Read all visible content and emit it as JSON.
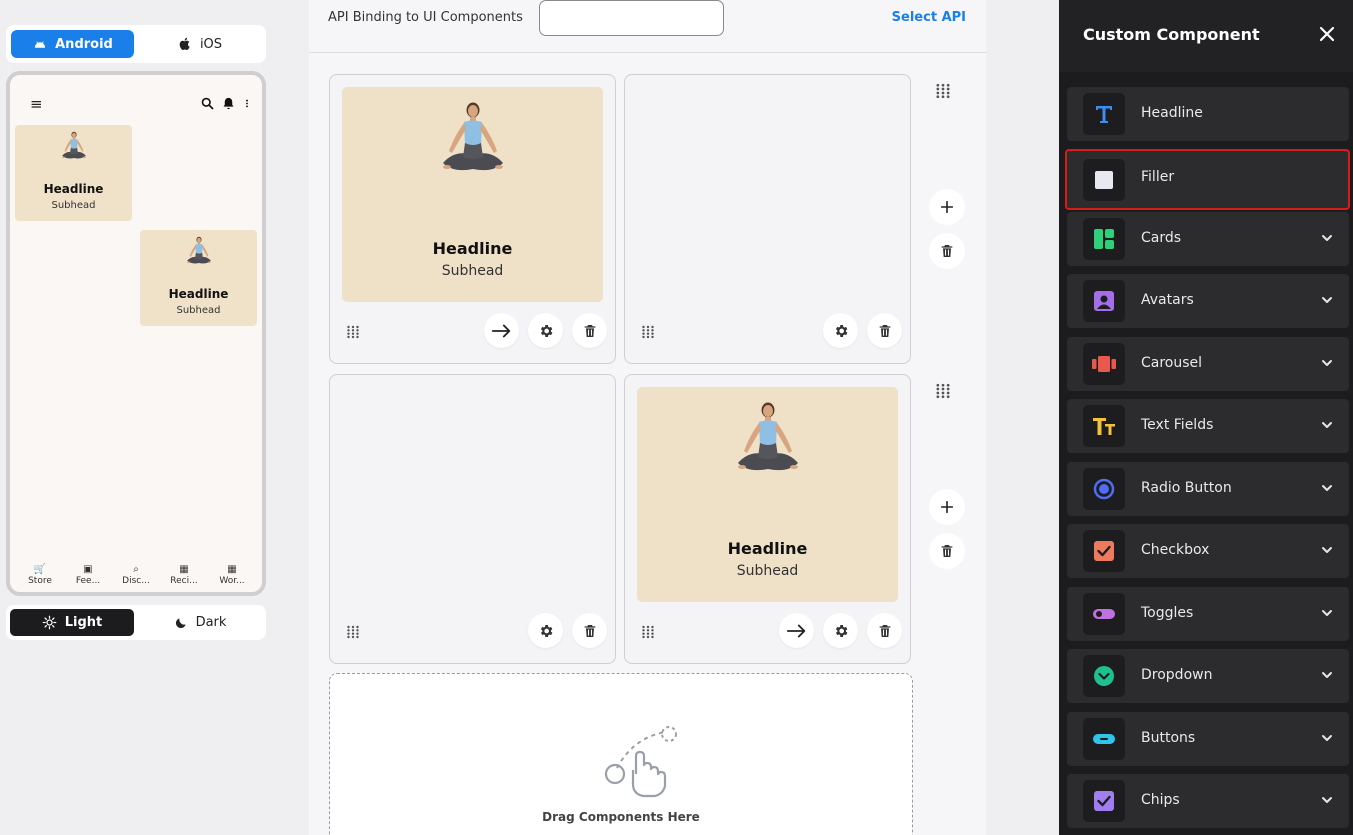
{
  "device_toggle": {
    "android_label": "Android",
    "ios_label": "iOS",
    "active": "Android",
    "accent": "#1a7fe8"
  },
  "phone": {
    "menu_icon": "≡",
    "cards": [
      {
        "headline": "Headline",
        "subhead": "Subhead"
      },
      {
        "headline": "Headline",
        "subhead": "Subhead"
      }
    ],
    "nav": [
      {
        "icon": "cart-icon",
        "label": "Store"
      },
      {
        "icon": "bag-icon",
        "label": "Fee..."
      },
      {
        "icon": "search-icon",
        "label": "Disc..."
      },
      {
        "icon": "grid-icon",
        "label": "Reci..."
      },
      {
        "icon": "grid-icon",
        "label": "Wor..."
      }
    ]
  },
  "theme_toggle": {
    "light_label": "Light",
    "dark_label": "Dark",
    "active": "Light"
  },
  "api_bar": {
    "label": "API Binding to UI Components",
    "input_value": "",
    "select_label": "Select API"
  },
  "canvas": {
    "slots": [
      {
        "headline": "Headline",
        "subhead": "Subhead",
        "has_card": true
      },
      {
        "has_card": false
      },
      {
        "has_card": false
      },
      {
        "headline": "Headline",
        "subhead": "Subhead",
        "has_card": true
      }
    ],
    "drop_label": "Drag Components Here"
  },
  "panel": {
    "title": "Custom Component",
    "items": [
      {
        "label": "Headline",
        "icon": "text-icon",
        "color": "#3b8cf5",
        "expandable": false
      },
      {
        "label": "Filler",
        "icon": "filler-icon",
        "color": "#e8e8f0",
        "expandable": false,
        "selected": true
      },
      {
        "label": "Cards",
        "icon": "cards-icon",
        "color": "#2fd07a",
        "expandable": true
      },
      {
        "label": "Avatars",
        "icon": "avatar-icon",
        "color": "#a46ee8",
        "expandable": true
      },
      {
        "label": "Carousel",
        "icon": "carousel-icon",
        "color": "#e8584c",
        "expandable": true
      },
      {
        "label": "Text Fields",
        "icon": "text-fields-icon",
        "color": "#f3c33c",
        "expandable": true
      },
      {
        "label": "Radio Button",
        "icon": "radio-icon",
        "color": "#4e6cf5",
        "expandable": true
      },
      {
        "label": "Checkbox",
        "icon": "checkbox-icon",
        "color": "#ef7b5f",
        "expandable": true
      },
      {
        "label": "Toggles",
        "icon": "toggle-icon",
        "color": "#c071e0",
        "expandable": true
      },
      {
        "label": "Dropdown",
        "icon": "dropdown-icon",
        "color": "#1fbf8f",
        "expandable": true
      },
      {
        "label": "Buttons",
        "icon": "buttons-icon",
        "color": "#2ec5e8",
        "expandable": true
      },
      {
        "label": "Chips",
        "icon": "chips-icon",
        "color": "#a07ef0",
        "expandable": true
      }
    ],
    "selected_outline": "#d81c1c"
  }
}
